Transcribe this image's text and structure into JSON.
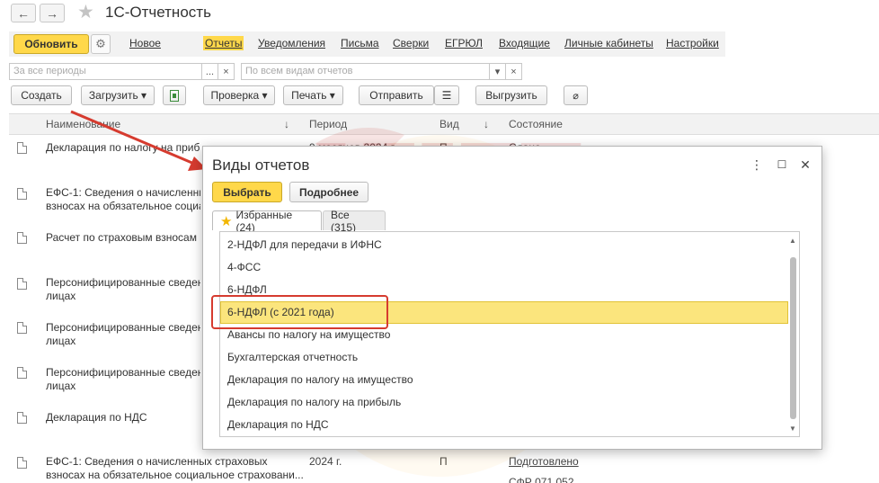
{
  "window": {
    "back_icon": "←",
    "forward_icon": "→",
    "title": "1С-Отчетность"
  },
  "toolbar": {
    "refresh_label": "Обновить",
    "gear_icon": "⚙",
    "menu": [
      "Новое",
      "Отчеты",
      "Уведомления",
      "Письма",
      "Сверки",
      "ЕГРЮЛ",
      "Входящие",
      "Личные кабинеты",
      "Настройки"
    ],
    "active_menu": "Отчеты"
  },
  "filters": {
    "period_placeholder": "За все периоды",
    "period_more": "...",
    "period_clear": "×",
    "type_placeholder": "По всем видам отчетов",
    "type_dropdown": "▾",
    "type_clear": "×"
  },
  "actions": {
    "create": "Создать",
    "load": "Загрузить ▾",
    "check": "Проверка ▾",
    "print": "Печать ▾",
    "send": "Отправить",
    "send_list_icon": "☰",
    "unload": "Выгрузить",
    "attach_icon": "📎"
  },
  "list": {
    "columns": {
      "name": "Наименование",
      "period": "Период",
      "type": "Вид",
      "sort_icon": "↓",
      "status": "Состояние"
    },
    "rows": [
      {
        "name": "Декларация по налогу на прибыль",
        "period": "9 месяцев 2024 г.",
        "type": "П",
        "status": "Сдано"
      },
      {
        "name": "ЕФС-1: Сведения о начисленных\nвзносах на обязательное социальное"
      },
      {
        "name": "Расчет по страховым взносам"
      },
      {
        "name": "Персонифицированные сведения о\nлицах"
      },
      {
        "name": "Персонифицированные сведения о\nлицах"
      },
      {
        "name": "Персонифицированные сведения о\nлицах"
      },
      {
        "name": "Декларация по НДС"
      },
      {
        "name": "ЕФС-1: Сведения о начисленных страховых\nвзносах на обязательное социальное страховани...",
        "period": "2024 г.",
        "type": "П",
        "status": "Подготовлено",
        "status2": "СФР 071.052"
      }
    ]
  },
  "watermark": {
    "line1": "УЧЕТ",
    "line2": "БЕЗ ЗАБОТ"
  },
  "dialog": {
    "title": "Виды отчетов",
    "more_icon": "⋮",
    "maximize_icon": "☐",
    "close_icon": "✕",
    "select_label": "Выбрать",
    "details_label": "Подробнее",
    "tab_favorites": "Избранные (24)",
    "tab_favorites_icon": "★",
    "tab_all": "Все (315)",
    "items": [
      "2-НДФЛ для передачи в ИФНС",
      "4-ФСС",
      "6-НДФЛ",
      "6-НДФЛ (с 2021 года)",
      "Авансы по налогу на имущество",
      "Бухгалтерская отчетность",
      "Декларация по налогу на имущество",
      "Декларация по налогу на прибыль",
      "Декларация по НДС"
    ],
    "selected_index": 3,
    "scroll_up": "▲",
    "scroll_down": "▼"
  },
  "colors": {
    "accent_yellow": "#ffd84a",
    "selection": "#fbe57d",
    "annotation_red": "#d63b2f"
  }
}
